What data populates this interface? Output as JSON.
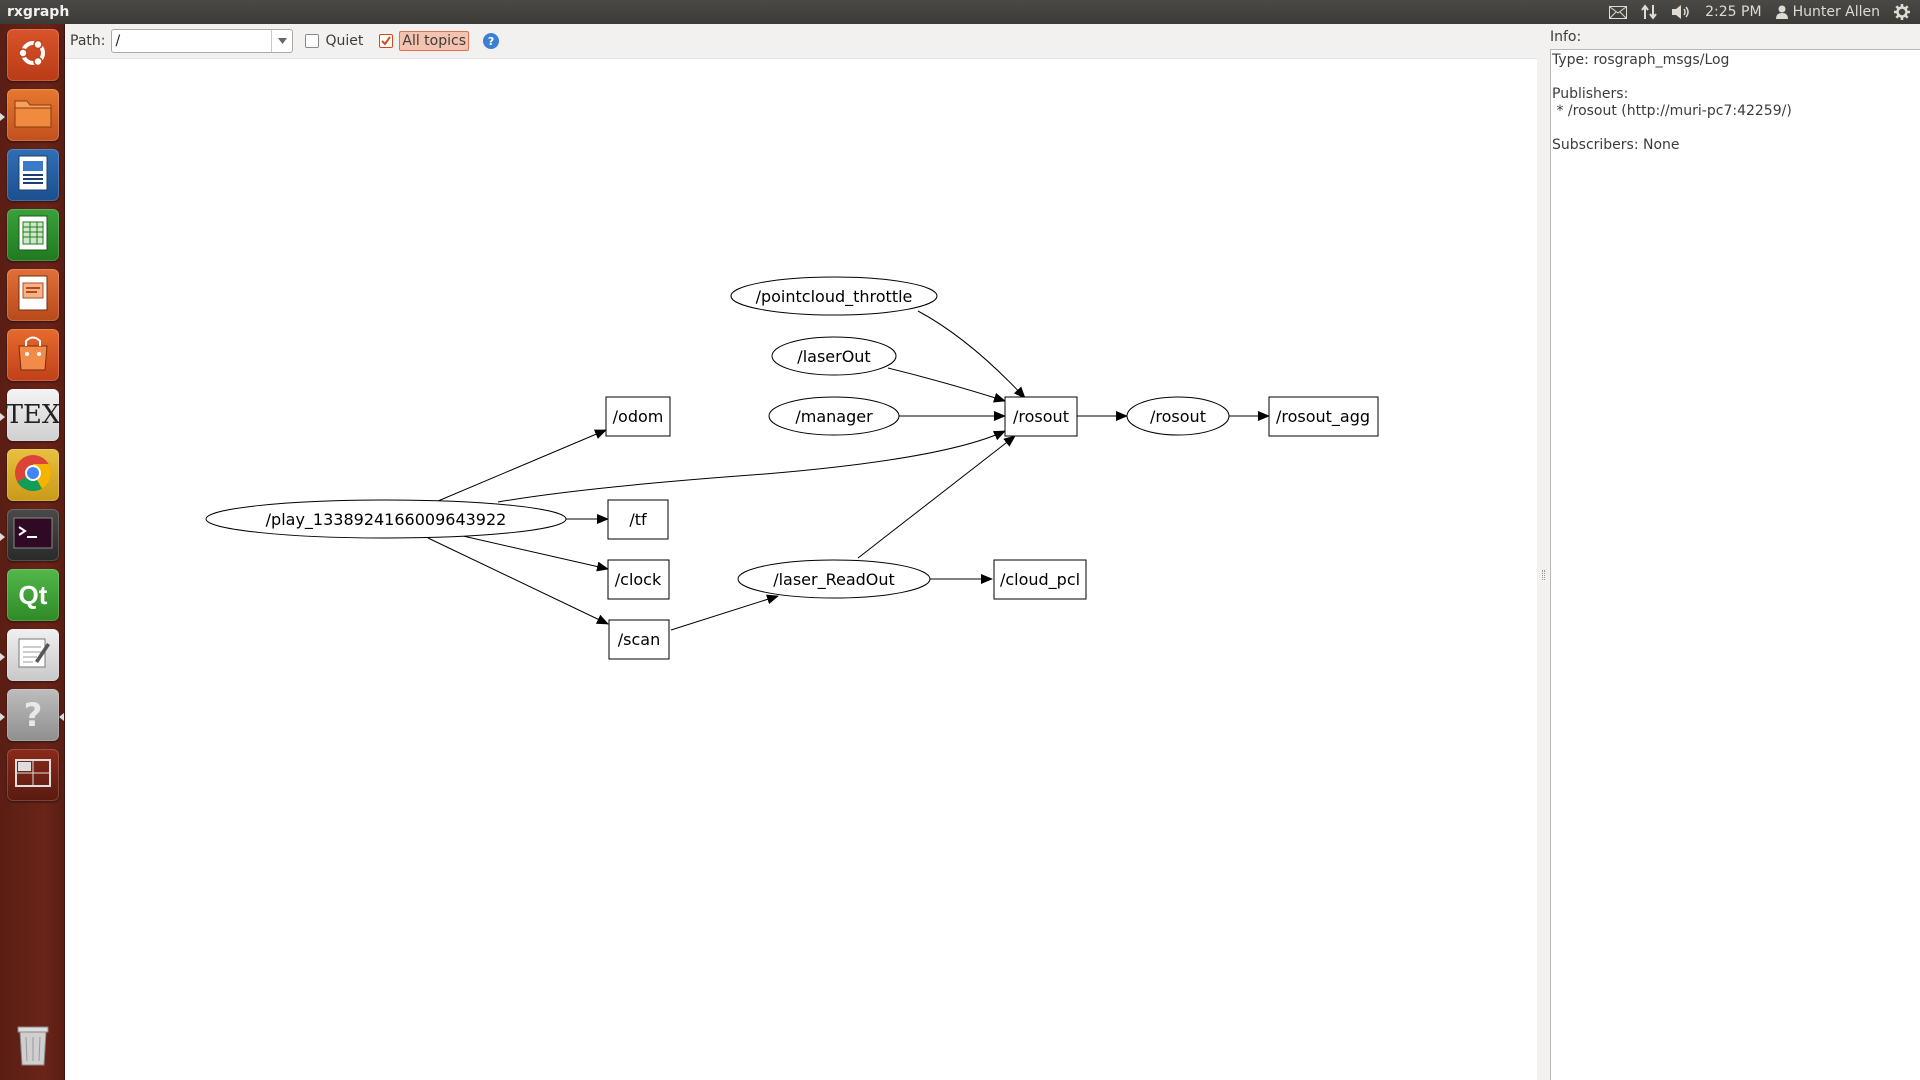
{
  "window": {
    "title": "rxgraph"
  },
  "top_panel": {
    "time": "2:25 PM",
    "user": "Hunter Allen",
    "icons": [
      "mail-icon",
      "network-icon",
      "volume-icon",
      "user-icon",
      "gear-icon"
    ]
  },
  "launcher": {
    "items": [
      {
        "name": "dash-home",
        "icon": "ubuntu-logo-icon"
      },
      {
        "name": "files",
        "icon": "folder-icon"
      },
      {
        "name": "libreoffice-writer",
        "icon": "writer-icon"
      },
      {
        "name": "libreoffice-calc",
        "icon": "calc-icon"
      },
      {
        "name": "libreoffice-impress",
        "icon": "impress-icon"
      },
      {
        "name": "software-center",
        "icon": "shopping-bag-icon"
      },
      {
        "name": "texmaker",
        "icon": "tex-icon",
        "label": "TEX"
      },
      {
        "name": "chrome",
        "icon": "chrome-icon"
      },
      {
        "name": "terminal",
        "icon": "terminal-icon"
      },
      {
        "name": "qt-creator",
        "icon": "qt-icon",
        "label": "Qt"
      },
      {
        "name": "text-editor",
        "icon": "text-editor-icon"
      },
      {
        "name": "help",
        "icon": "help-icon",
        "label": "?"
      },
      {
        "name": "workspaces",
        "icon": "workspace-icon"
      },
      {
        "name": "trash",
        "icon": "trash-icon"
      }
    ]
  },
  "toolbar": {
    "path_label": "Path:",
    "path_value": "/",
    "quiet_label": "Quiet",
    "quiet_checked": false,
    "all_topics_label": "All topics",
    "all_topics_checked": true,
    "help_glyph": "?"
  },
  "graph": {
    "nodes": [
      {
        "id": "pointcloud_throttle",
        "label": "/pointcloud_throttle",
        "shape": "ellipse"
      },
      {
        "id": "laserOut",
        "label": "/laserOut",
        "shape": "ellipse"
      },
      {
        "id": "manager",
        "label": "/manager",
        "shape": "ellipse"
      },
      {
        "id": "rosout_topic",
        "label": "/rosout",
        "shape": "box"
      },
      {
        "id": "rosout_node",
        "label": "/rosout",
        "shape": "ellipse"
      },
      {
        "id": "rosout_agg",
        "label": "/rosout_agg",
        "shape": "box"
      },
      {
        "id": "odom",
        "label": "/odom",
        "shape": "box"
      },
      {
        "id": "play",
        "label": "/play_1338924166009643922",
        "shape": "ellipse"
      },
      {
        "id": "tf",
        "label": "/tf",
        "shape": "box"
      },
      {
        "id": "clock",
        "label": "/clock",
        "shape": "box"
      },
      {
        "id": "laser_ReadOut",
        "label": "/laser_ReadOut",
        "shape": "ellipse"
      },
      {
        "id": "cloud_pcl",
        "label": "/cloud_pcl",
        "shape": "box"
      },
      {
        "id": "scan",
        "label": "/scan",
        "shape": "box"
      }
    ],
    "edges": [
      [
        "pointcloud_throttle",
        "rosout_topic"
      ],
      [
        "laserOut",
        "rosout_topic"
      ],
      [
        "manager",
        "rosout_topic"
      ],
      [
        "play",
        "rosout_topic"
      ],
      [
        "laser_ReadOut",
        "rosout_topic"
      ],
      [
        "rosout_topic",
        "rosout_node"
      ],
      [
        "rosout_node",
        "rosout_agg"
      ],
      [
        "play",
        "odom"
      ],
      [
        "play",
        "tf"
      ],
      [
        "play",
        "clock"
      ],
      [
        "play",
        "scan"
      ],
      [
        "scan",
        "laser_ReadOut"
      ],
      [
        "laser_ReadOut",
        "cloud_pcl"
      ]
    ]
  },
  "info": {
    "label": "Info:",
    "type_line": "Type: rosgraph_msgs/Log",
    "publishers_label": "Publishers:",
    "publisher_line": " * /rosout (http://muri-pc7:42259/)",
    "subscribers_line": "Subscribers: None"
  }
}
